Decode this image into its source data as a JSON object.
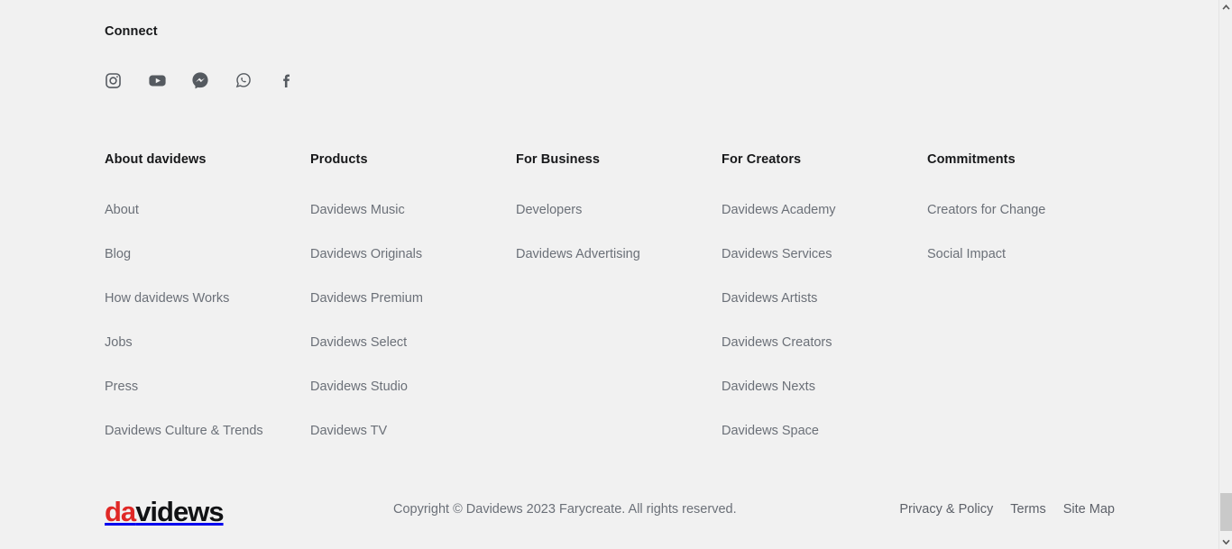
{
  "connect": {
    "title": "Connect",
    "socials": [
      {
        "name": "instagram",
        "label": "Instagram"
      },
      {
        "name": "youtube",
        "label": "YouTube"
      },
      {
        "name": "messenger",
        "label": "Facebook Messenger"
      },
      {
        "name": "whatsapp",
        "label": "WhatsApp"
      },
      {
        "name": "facebook",
        "label": "Facebook"
      }
    ]
  },
  "columns": [
    {
      "title": "About davidews",
      "links": [
        "About",
        "Blog",
        "How davidews Works",
        "Jobs",
        "Press",
        "Davidews Culture & Trends"
      ]
    },
    {
      "title": "Products",
      "links": [
        "Davidews Music",
        "Davidews Originals",
        "Davidews Premium",
        "Davidews Select",
        "Davidews Studio",
        "Davidews TV"
      ]
    },
    {
      "title": "For Business",
      "links": [
        "Developers",
        "Davidews Advertising"
      ]
    },
    {
      "title": "For Creators",
      "links": [
        "Davidews Academy",
        "Davidews Services",
        "Davidews Artists",
        "Davidews Creators",
        "Davidews Nexts",
        "Davidews Space"
      ]
    },
    {
      "title": "Commitments",
      "links": [
        "Creators for Change",
        "Social Impact"
      ]
    }
  ],
  "bottom": {
    "logo_prefix": "da",
    "logo_suffix": "videws",
    "copyright": "Copyright © Davidews 2023 Farycreate. All rights reserved.",
    "legal_links": [
      "Privacy & Policy",
      "Terms",
      "Site Map"
    ]
  },
  "colors": {
    "background": "#f1f1f1",
    "heading": "#17181a",
    "link": "#6b7078",
    "logo_accent": "#e02826",
    "logo_base": "#111214",
    "icon": "#555a60"
  },
  "scrollbar": {
    "up_arrow": "⌃",
    "down_arrow": "⌄"
  }
}
